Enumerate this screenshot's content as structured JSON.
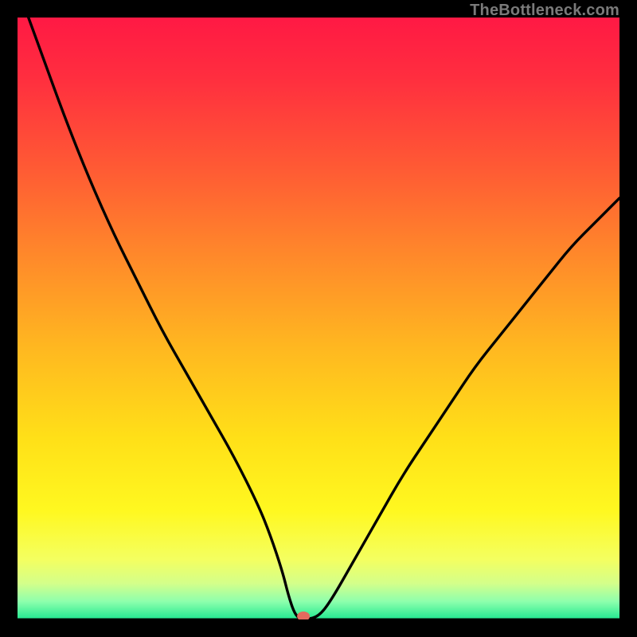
{
  "watermark": "TheBottleneck.com",
  "chart_data": {
    "type": "line",
    "title": "",
    "xlabel": "",
    "ylabel": "",
    "xlim": [
      0,
      100
    ],
    "ylim": [
      0,
      100
    ],
    "series": [
      {
        "name": "bottleneck-curve",
        "x": [
          0,
          4,
          8,
          12,
          16,
          20,
          24,
          28,
          32,
          36,
          40,
          42,
          44,
          45,
          46,
          47,
          48,
          50,
          52,
          56,
          60,
          64,
          68,
          72,
          76,
          80,
          84,
          88,
          92,
          96,
          100
        ],
        "y": [
          105,
          94,
          83,
          73,
          64,
          56,
          48,
          41,
          34,
          27,
          19,
          14,
          8,
          4,
          1,
          0,
          0,
          0.5,
          3,
          10,
          17,
          24,
          30,
          36,
          42,
          47,
          52,
          57,
          62,
          66,
          70
        ]
      }
    ],
    "gradient_stops": [
      {
        "offset": 0.0,
        "color": "#ff1944"
      },
      {
        "offset": 0.1,
        "color": "#ff2e3f"
      },
      {
        "offset": 0.25,
        "color": "#ff5a34"
      },
      {
        "offset": 0.4,
        "color": "#ff8a2a"
      },
      {
        "offset": 0.55,
        "color": "#ffb820"
      },
      {
        "offset": 0.7,
        "color": "#ffe018"
      },
      {
        "offset": 0.82,
        "color": "#fff820"
      },
      {
        "offset": 0.9,
        "color": "#f4ff60"
      },
      {
        "offset": 0.94,
        "color": "#d4ff8a"
      },
      {
        "offset": 0.97,
        "color": "#8effad"
      },
      {
        "offset": 1.0,
        "color": "#20e890"
      }
    ],
    "marker": {
      "x": 47.5,
      "y": 0,
      "color": "#e46a5e"
    },
    "baseline_y": 0,
    "baseline_color": "#000000"
  }
}
